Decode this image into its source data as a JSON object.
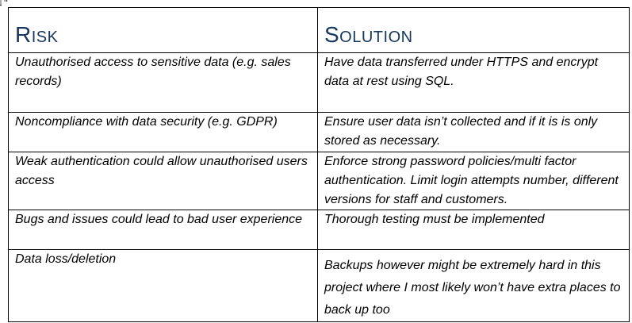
{
  "table": {
    "headers": {
      "risk": "Risk",
      "solution": "Solution"
    },
    "rows": [
      {
        "risk": "Unauthorised access to sensitive data (e.g. sales records)",
        "solution": "Have data transferred under HTTPS and encrypt data at rest using SQL."
      },
      {
        "risk": "Noncompliance with data security (e.g. GDPR)",
        "solution": "Ensure user data isn’t collected and if it is is only stored as necessary."
      },
      {
        "risk": "Weak authentication could allow unauthorised users access",
        "solution": "Enforce strong password policies/multi factor authentication. Limit login attempts number, different versions for staff and customers."
      },
      {
        "risk": "Bugs and issues could lead to bad user experience",
        "solution": "Thorough testing must be implemented"
      },
      {
        "risk": "Data loss/deletion",
        "solution": "Backups however might be extremely hard in this project where I most likely won’t have extra places to back up too"
      }
    ]
  }
}
